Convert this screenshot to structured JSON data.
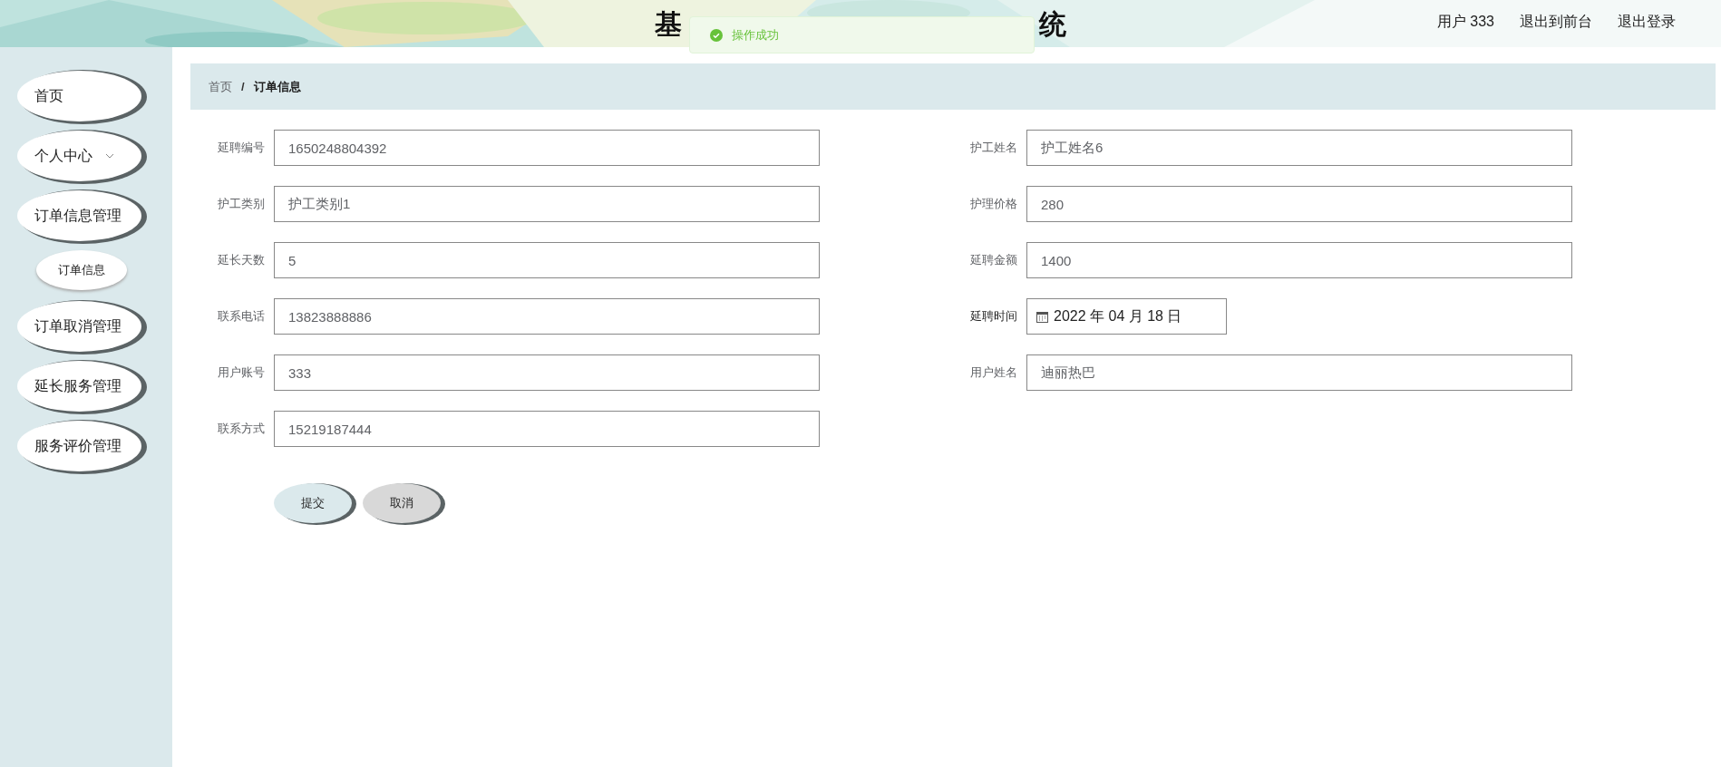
{
  "header": {
    "title_parts": [
      "基",
      "统"
    ],
    "user": "用户 333",
    "links": [
      "退出到前台",
      "退出登录"
    ]
  },
  "toast": {
    "kind": "success",
    "message": "操作成功"
  },
  "sidebar": {
    "items": [
      {
        "label": "首页",
        "kind": "plain"
      },
      {
        "label": "个人中心",
        "kind": "caret"
      },
      {
        "label": "订单信息管理",
        "kind": "plain",
        "children": [
          {
            "label": "订单信息"
          }
        ]
      },
      {
        "label": "订单取消管理",
        "kind": "plain"
      },
      {
        "label": "延长服务管理",
        "kind": "plain"
      },
      {
        "label": "服务评价管理",
        "kind": "plain"
      }
    ]
  },
  "breadcrumb": [
    "首页",
    "订单信息"
  ],
  "breadcrumb_separator": "/",
  "form": {
    "left": [
      {
        "label": "延聘编号",
        "value": "1650248804392",
        "kind": "text"
      },
      {
        "label": "护工类别",
        "value": "护工类别1",
        "kind": "text"
      },
      {
        "label": "延长天数",
        "value": "5",
        "kind": "text"
      },
      {
        "label": "联系电话",
        "value": "13823888886",
        "kind": "text"
      },
      {
        "label": "用户账号",
        "value": "333",
        "kind": "text"
      },
      {
        "label": "联系方式",
        "value": "15219187444",
        "kind": "text"
      }
    ],
    "right": [
      {
        "label": "护工姓名",
        "value": "护工姓名6",
        "kind": "text"
      },
      {
        "label": "护理价格",
        "value": "280",
        "kind": "text"
      },
      {
        "label": "延聘金额",
        "value": "1400",
        "kind": "text"
      },
      {
        "label": "延聘时间",
        "value": "2022 年 04 月 18 日",
        "kind": "date"
      },
      {
        "label": "用户姓名",
        "value": "迪丽热巴",
        "kind": "text"
      }
    ],
    "buttons": [
      {
        "label": "提交",
        "kind": "primary"
      },
      {
        "label": "取消",
        "kind": "secondary"
      }
    ]
  }
}
